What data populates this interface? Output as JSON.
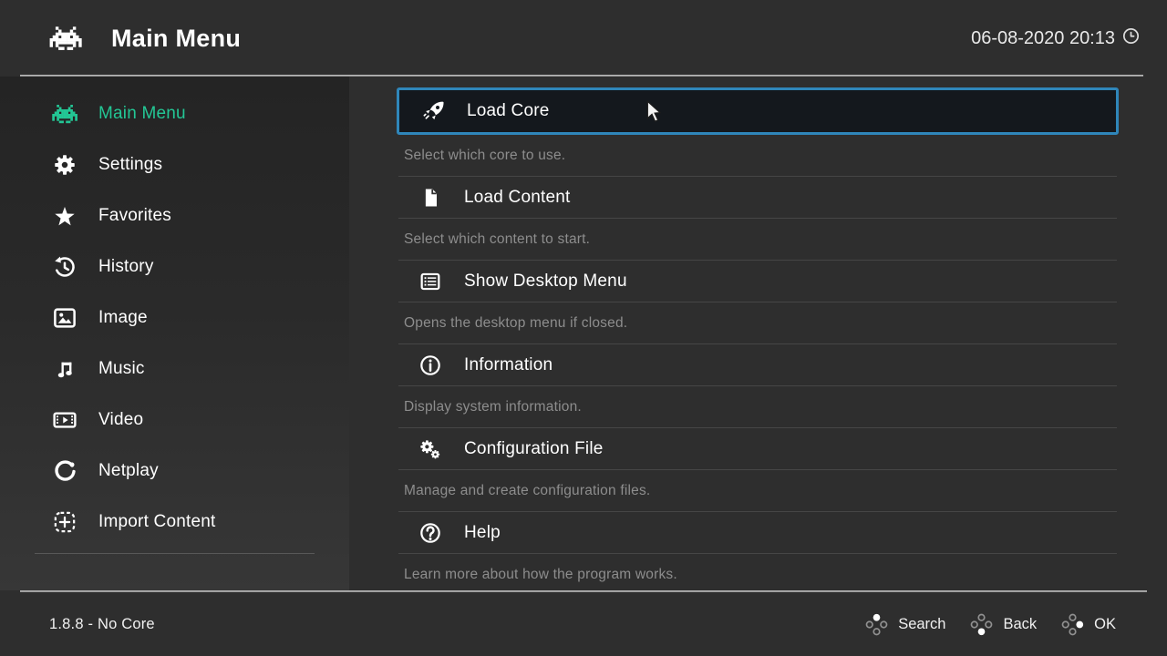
{
  "header": {
    "title": "Main Menu",
    "datetime": "06-08-2020 20:13",
    "logo_icon": "retroarch-logo",
    "clock_icon": "clock"
  },
  "sidebar": {
    "items": [
      {
        "label": "Main Menu",
        "icon": "retroarch-logo",
        "active": true
      },
      {
        "label": "Settings",
        "icon": "gear",
        "active": false
      },
      {
        "label": "Favorites",
        "icon": "star",
        "active": false
      },
      {
        "label": "History",
        "icon": "history",
        "active": false
      },
      {
        "label": "Image",
        "icon": "image",
        "active": false
      },
      {
        "label": "Music",
        "icon": "music",
        "active": false
      },
      {
        "label": "Video",
        "icon": "video",
        "active": false
      },
      {
        "label": "Netplay",
        "icon": "netplay",
        "active": false
      },
      {
        "label": "Import Content",
        "icon": "import",
        "active": false
      }
    ]
  },
  "menu": {
    "entries": [
      {
        "label": "Load Core",
        "sublabel": "Select which core to use.",
        "icon": "rocket",
        "selected": true
      },
      {
        "label": "Load Content",
        "sublabel": "Select which content to start.",
        "icon": "file",
        "selected": false
      },
      {
        "label": "Show Desktop Menu",
        "sublabel": "Opens the desktop menu if closed.",
        "icon": "desktop-menu",
        "selected": false
      },
      {
        "label": "Information",
        "sublabel": "Display system information.",
        "icon": "info",
        "selected": false
      },
      {
        "label": "Configuration File",
        "sublabel": "Manage and create configuration files.",
        "icon": "config-file",
        "selected": false
      },
      {
        "label": "Help",
        "sublabel": "Learn more about how the program works.",
        "icon": "help",
        "selected": false
      }
    ]
  },
  "bottom": {
    "version": "1.8.8 - No Core",
    "hints": [
      {
        "label": "Search",
        "icon": "pad-cluster",
        "filled": "top"
      },
      {
        "label": "Back",
        "icon": "pad-cluster",
        "filled": "bottom"
      },
      {
        "label": "OK",
        "icon": "pad-cluster",
        "filled": "right"
      }
    ]
  },
  "colors": {
    "background": "#2e2e2e",
    "accent_green": "#23c795",
    "selection_border": "#2f86ba",
    "selection_bg": "#14181d",
    "sublabel_gray": "#8d8d8d",
    "divider": "#464646"
  }
}
